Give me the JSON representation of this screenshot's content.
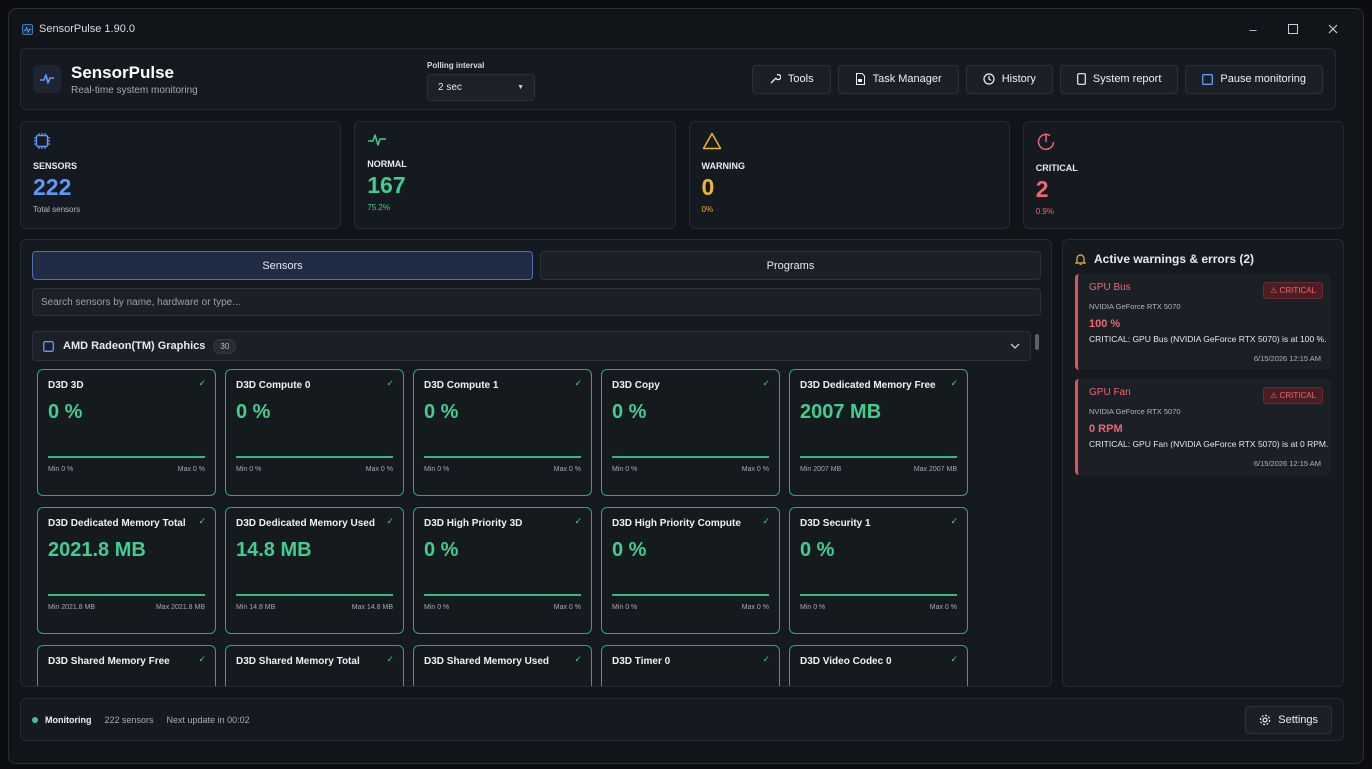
{
  "window": {
    "title": "SensorPulse 1.90.0"
  },
  "header": {
    "brand": "SensorPulse",
    "subtitle": "Real-time system monitoring",
    "polling_label": "Polling interval",
    "polling_value": "2 sec",
    "buttons": {
      "tools": "Tools",
      "task_manager": "Task Manager",
      "history": "History",
      "system_report": "System report",
      "pause": "Pause monitoring"
    }
  },
  "stats": [
    {
      "label": "SENSORS",
      "value": "222",
      "sub": "Total sensors",
      "color": "#5b9cf5",
      "icon": "chip-icon"
    },
    {
      "label": "NORMAL",
      "value": "167",
      "sub": "75.2%",
      "color": "#3fcf8e",
      "icon": "pulse-icon"
    },
    {
      "label": "WARNING",
      "value": "0",
      "sub": "0%",
      "color": "#f2b434",
      "icon": "warning-icon"
    },
    {
      "label": "CRITICAL",
      "value": "2",
      "sub": "0.9%",
      "color": "#f1656e",
      "icon": "critical-icon"
    }
  ],
  "tabs": {
    "sensors": "Sensors",
    "programs": "Programs"
  },
  "search": {
    "placeholder": "Search sensors by name, hardware or type..."
  },
  "group": {
    "name": "AMD Radeon(TM) Graphics",
    "count": "30"
  },
  "cards": [
    {
      "name": "D3D 3D",
      "value": "0 %",
      "min": "Min 0 %",
      "max": "Max 0 %"
    },
    {
      "name": "D3D Compute 0",
      "value": "0 %",
      "min": "Min 0 %",
      "max": "Max 0 %"
    },
    {
      "name": "D3D Compute 1",
      "value": "0 %",
      "min": "Min 0 %",
      "max": "Max 0 %"
    },
    {
      "name": "D3D Copy",
      "value": "0 %",
      "min": "Min 0 %",
      "max": "Max 0 %"
    },
    {
      "name": "D3D Dedicated Memory Free",
      "value": "2007 MB",
      "min": "Min 2007 MB",
      "max": "Max 2007 MB"
    },
    {
      "name": "D3D Dedicated Memory Total",
      "value": "2021.8 MB",
      "min": "Min 2021.8 MB",
      "max": "Max 2021.8 MB"
    },
    {
      "name": "D3D Dedicated Memory Used",
      "value": "14.8 MB",
      "min": "Min 14.8 MB",
      "max": "Max 14.8 MB"
    },
    {
      "name": "D3D High Priority 3D",
      "value": "0 %",
      "min": "Min 0 %",
      "max": "Max 0 %"
    },
    {
      "name": "D3D High Priority Compute",
      "value": "0 %",
      "min": "Min 0 %",
      "max": "Max 0 %"
    },
    {
      "name": "D3D Security 1",
      "value": "0 %",
      "min": "Min 0 %",
      "max": "Max 0 %"
    },
    {
      "name": "D3D Shared Memory Free",
      "value": "",
      "min": "",
      "max": ""
    },
    {
      "name": "D3D Shared Memory Total",
      "value": "",
      "min": "",
      "max": ""
    },
    {
      "name": "D3D Shared Memory Used",
      "value": "",
      "min": "",
      "max": ""
    },
    {
      "name": "D3D Timer 0",
      "value": "",
      "min": "",
      "max": ""
    },
    {
      "name": "D3D Video Codec 0",
      "value": "",
      "min": "",
      "max": ""
    }
  ],
  "alerts": {
    "title": "Active warnings & errors (2)",
    "items": [
      {
        "name": "GPU Bus",
        "badge": "⚠ CRITICAL",
        "hardware": "NVIDIA GeForce RTX 5070",
        "value": "100 %",
        "message": "CRITICAL: GPU Bus (NVIDIA GeForce RTX 5070) is at 100 %.",
        "time": "6/15/2026 12:15 AM"
      },
      {
        "name": "GPU Fan",
        "badge": "⚠ CRITICAL",
        "hardware": "NVIDIA GeForce RTX 5070",
        "value": "0 RPM",
        "message": "CRITICAL: GPU Fan (NVIDIA GeForce RTX 5070) is at 0 RPM.",
        "time": "6/15/2026 12:15 AM"
      }
    ]
  },
  "footer": {
    "status": "Monitoring",
    "count": "222 sensors",
    "next_update": "Next update in 00:02",
    "settings": "Settings"
  }
}
